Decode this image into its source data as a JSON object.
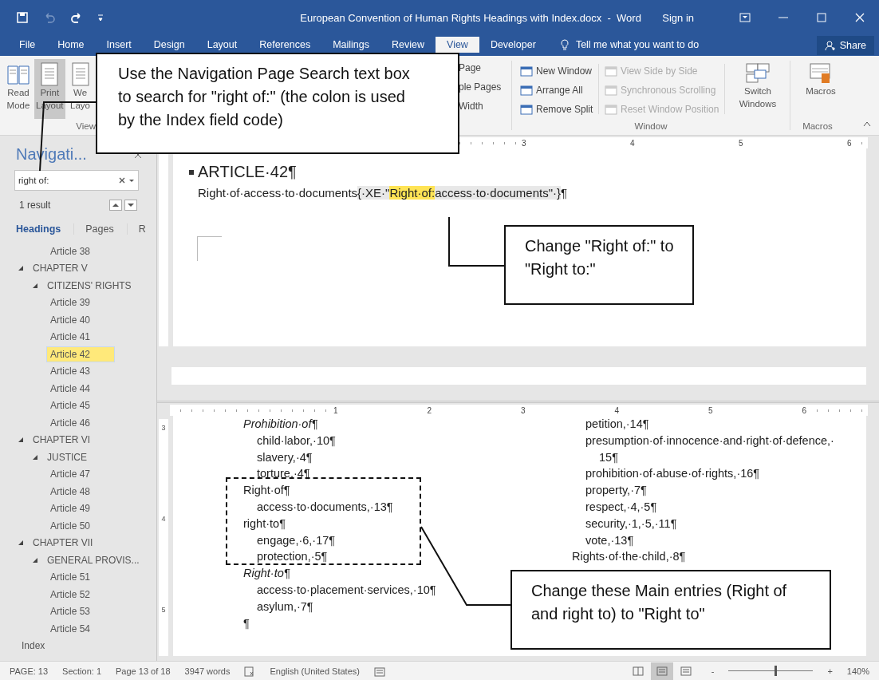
{
  "window": {
    "title": "European Convention of Human Rights Headings with Index.docx  -  Word",
    "sign_in": "Sign in"
  },
  "tabs": [
    {
      "label": "File",
      "selected": false
    },
    {
      "label": "Home",
      "selected": false
    },
    {
      "label": "Insert",
      "selected": false
    },
    {
      "label": "Design",
      "selected": false
    },
    {
      "label": "Layout",
      "selected": false
    },
    {
      "label": "References",
      "selected": false
    },
    {
      "label": "Mailings",
      "selected": false
    },
    {
      "label": "Review",
      "selected": false
    },
    {
      "label": "View",
      "selected": true
    },
    {
      "label": "Developer",
      "selected": false
    }
  ],
  "tell_me": {
    "placeholder": "Tell me what you want to do"
  },
  "share": "Share",
  "ribbon": {
    "views": {
      "label": "View",
      "buttons": [
        {
          "lines": [
            "Read",
            "Mode"
          ],
          "selected": false
        },
        {
          "lines": [
            "Print",
            "Layout"
          ],
          "selected": true
        },
        {
          "lines": [
            "We",
            "Layo"
          ],
          "selected": false
        }
      ]
    },
    "zoom_partial": [
      "Page",
      "ple Pages",
      "Width"
    ],
    "window_group": {
      "label": "Window",
      "items": [
        {
          "label": "New Window",
          "disabled": false
        },
        {
          "label": "Arrange All",
          "disabled": false
        },
        {
          "label": "Remove Split",
          "disabled": false
        },
        {
          "label": "View Side by Side",
          "disabled": true
        },
        {
          "label": "Synchronous Scrolling",
          "disabled": true
        },
        {
          "label": "Reset Window Position",
          "disabled": true
        }
      ],
      "switch": [
        "Switch",
        "Windows"
      ]
    },
    "macros_group": {
      "label": "Macros",
      "button": "Macros"
    }
  },
  "navigation": {
    "title": "Navigati...",
    "search": {
      "value": "right of:"
    },
    "result": "1 result",
    "tabs": [
      {
        "label": "Headings",
        "selected": true
      },
      {
        "label": "Pages",
        "selected": false
      },
      {
        "label": "R",
        "selected": false
      }
    ],
    "tree": [
      {
        "children": [
          {
            "children": [
              {
                "label": "Article 38",
                "selected": false
              }
            ]
          }
        ]
      },
      {
        "label": "CHAPTER V",
        "expanded": true,
        "children": [
          {
            "label": "CITIZENS' RIGHTS",
            "expanded": true,
            "children": [
              {
                "label": "Article 39",
                "selected": false
              },
              {
                "label": "Article 40",
                "selected": false
              },
              {
                "label": "Article 41",
                "selected": false
              },
              {
                "label": "Article 42",
                "selected": true
              },
              {
                "label": "Article 43",
                "selected": false
              },
              {
                "label": "Article 44",
                "selected": false
              },
              {
                "label": "Article 45",
                "selected": false
              },
              {
                "label": "Article 46",
                "selected": false
              }
            ]
          }
        ]
      },
      {
        "label": "CHAPTER VI",
        "expanded": true,
        "children": [
          {
            "label": "JUSTICE",
            "expanded": true,
            "children": [
              {
                "label": "Article 47",
                "selected": false
              },
              {
                "label": "Article 48",
                "selected": false
              },
              {
                "label": "Article 49",
                "selected": false
              },
              {
                "label": "Article 50",
                "selected": false
              }
            ]
          }
        ]
      },
      {
        "label": "CHAPTER VII",
        "expanded": true,
        "children": [
          {
            "label": "GENERAL PROVIS...",
            "expanded": true,
            "children": [
              {
                "label": "Article 51",
                "selected": false
              },
              {
                "label": "Article 52",
                "selected": false
              },
              {
                "label": "Article 53",
                "selected": false
              },
              {
                "label": "Article 54",
                "selected": false
              }
            ]
          }
        ]
      },
      {
        "label": "Index",
        "selected": false
      }
    ]
  },
  "top_pane": {
    "ruler": [
      "3",
      "4",
      "5",
      "6"
    ],
    "heading": "ARTICLE·42¶",
    "line": [
      {
        "kind": "text",
        "text": "Right·of·access·to·documents"
      },
      {
        "kind": "field",
        "text": "{·XE·\""
      },
      {
        "kind": "match",
        "text": "Right·of:"
      },
      {
        "kind": "field",
        "text": "access·to·documents\"·}"
      },
      {
        "kind": "text",
        "text": "¶"
      }
    ]
  },
  "bottom_pane": {
    "ruler": [
      "1",
      "2",
      "3",
      "4",
      "5",
      "6"
    ],
    "vruler": [
      "3",
      "4",
      "5"
    ],
    "left_column": [
      {
        "kind": "main",
        "text": "Prohibition·of¶",
        "italic": true
      },
      {
        "kind": "sub",
        "text": "child·labor,·10¶"
      },
      {
        "kind": "sub",
        "text": "slavery,·4¶"
      },
      {
        "kind": "sub",
        "text": "torture,·4¶"
      },
      {
        "kind": "main",
        "text": "Right·of¶"
      },
      {
        "kind": "sub",
        "text": "access·to·documents,·13¶"
      },
      {
        "kind": "main",
        "text": "right·to¶"
      },
      {
        "kind": "sub",
        "text": "engage,·6,·17¶"
      },
      {
        "kind": "sub",
        "text": "protection,·5¶"
      },
      {
        "kind": "main",
        "text": "Right·to¶",
        "italic": true
      },
      {
        "kind": "sub",
        "text": "access·to·placement·services,·10¶"
      },
      {
        "kind": "sub",
        "text": "asylum,·7¶"
      },
      {
        "kind": "main",
        "text": "¶"
      }
    ],
    "right_column": [
      {
        "kind": "sub",
        "text": "petition,·14¶"
      },
      {
        "kind": "sub",
        "text": "presumption·of·innocence·and·right·of·defence,·"
      },
      {
        "kind": "cont",
        "text": "15¶"
      },
      {
        "kind": "sub",
        "text": "prohibition·of·abuse·of·rights,·16¶"
      },
      {
        "kind": "sub",
        "text": "property,·7¶"
      },
      {
        "kind": "sub",
        "text": "respect,·4,·5¶"
      },
      {
        "kind": "sub",
        "text": "security,·1,·5,·11¶"
      },
      {
        "kind": "sub",
        "text": "vote,·13¶"
      },
      {
        "kind": "main",
        "text": "Rights·of·the·child,·8¶"
      }
    ]
  },
  "callouts": [
    {
      "text": "Use the Navigation Page Search text box to search for \"right of:\" (the colon is used by the Index field code)"
    },
    {
      "text": "Change \"Right of:\" to \"Right to:\""
    },
    {
      "text": "Change these Main entries (Right of and right to) to \"Right to\""
    }
  ],
  "status_bar": {
    "page": "PAGE: 13",
    "section": "Section: 1",
    "pages": "Page 13 of 18",
    "words": "3947 words",
    "language": "English (United States)",
    "views": [
      {
        "selected": false
      },
      {
        "selected": true
      },
      {
        "selected": false
      }
    ],
    "zoom_out": "-",
    "zoom": {
      "level": 0.55
    },
    "zoom_in": "+",
    "zoom_reading": "140%"
  }
}
